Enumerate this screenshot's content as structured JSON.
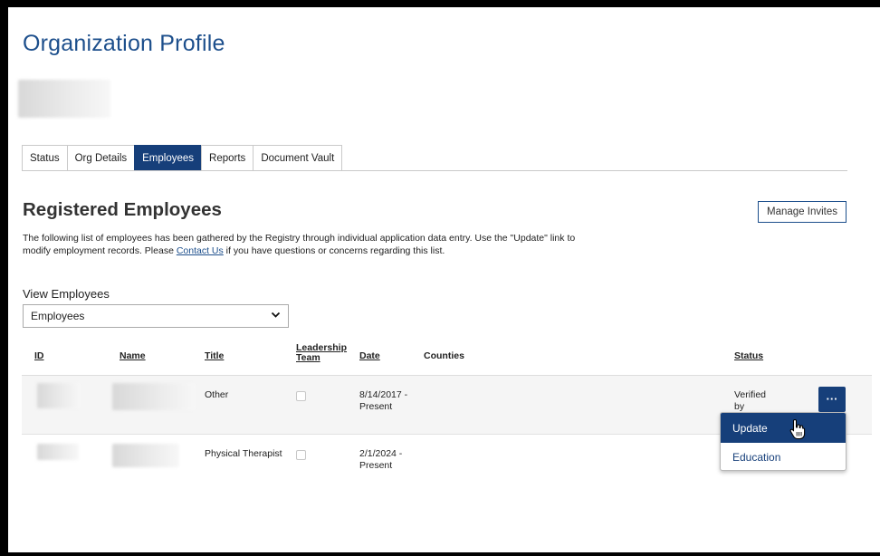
{
  "page": {
    "title": "Organization Profile"
  },
  "tabs": [
    {
      "label": "Status",
      "active": false
    },
    {
      "label": "Org Details",
      "active": false
    },
    {
      "label": "Employees",
      "active": true
    },
    {
      "label": "Reports",
      "active": false
    },
    {
      "label": "Document Vault",
      "active": false
    }
  ],
  "section": {
    "title": "Registered Employees",
    "manage_invites_label": "Manage Invites",
    "description_part1": "The following list of employees has been gathered by the Registry through individual application data entry. Use the \"Update\" link to modify employment records. Please ",
    "contact_link": "Contact Us",
    "description_part2": " if you have questions or concerns regarding this list."
  },
  "view_employees": {
    "label": "View Employees",
    "selected": "Employees"
  },
  "table": {
    "headers": {
      "id": "ID",
      "name": "Name",
      "title": "Title",
      "leadership_line1": "Leadership",
      "leadership_line2": "Team",
      "date": "Date",
      "counties": "Counties",
      "status": "Status"
    },
    "rows": [
      {
        "title": "Other",
        "date_line1": "8/14/2017 -",
        "date_line2": "Present",
        "status_line1": "Verified",
        "status_line2": "by"
      },
      {
        "title": "Physical Therapist",
        "date_line1": "2/1/2024 -",
        "date_line2": "Present"
      }
    ],
    "more_button": "···"
  },
  "row_menu": {
    "items": [
      {
        "label": "Update",
        "active": true
      },
      {
        "label": "Education",
        "active": false
      }
    ]
  },
  "colors": {
    "brand": "#163f7a",
    "title": "#1d4f8c"
  }
}
